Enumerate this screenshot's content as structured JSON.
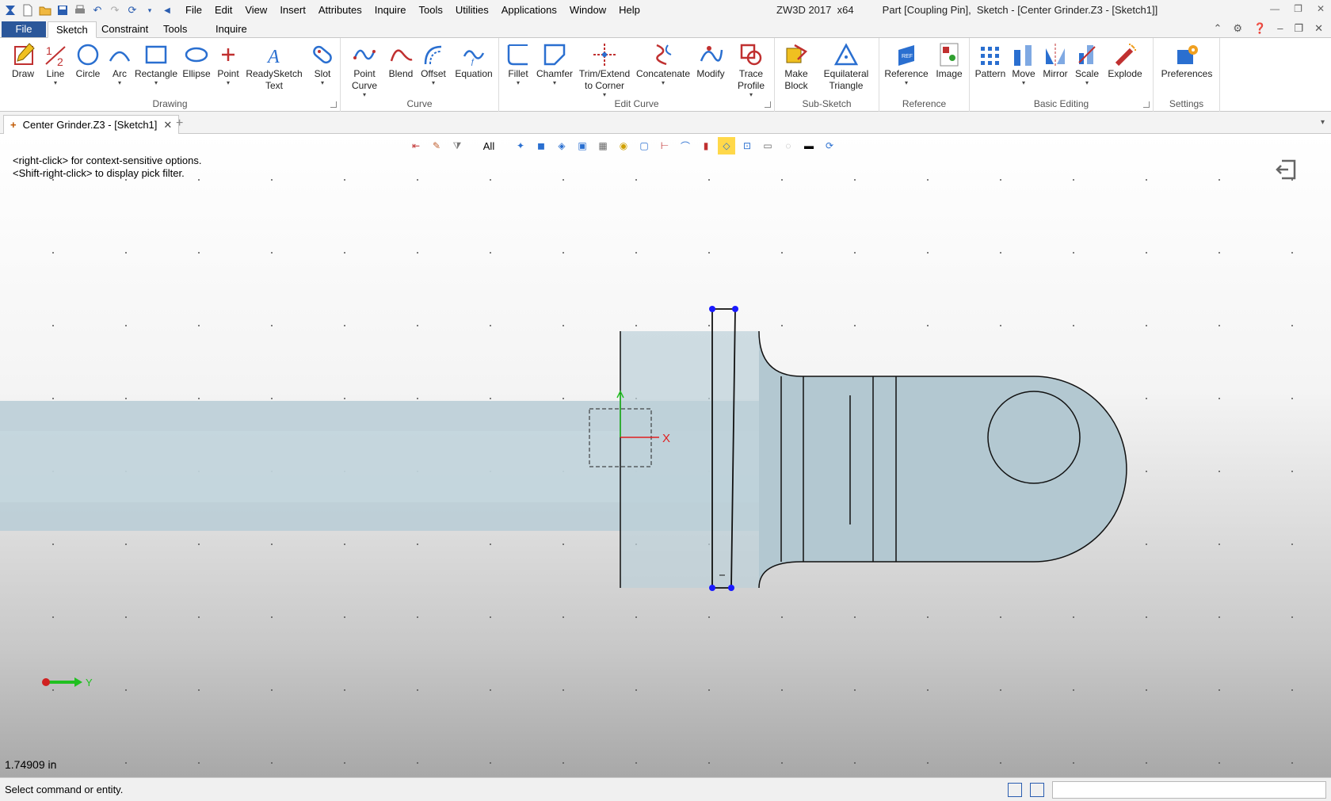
{
  "app": {
    "title": "ZW3D 2017  x64",
    "document_title": "Part [Coupling Pin],  Sketch - [Center Grinder.Z3 - [Sketch1]]"
  },
  "menu": [
    "File",
    "Edit",
    "View",
    "Insert",
    "Attributes",
    "Inquire",
    "Tools",
    "Utilities",
    "Applications",
    "Window",
    "Help"
  ],
  "ribbon_tabs": {
    "file": "File",
    "tabs": [
      "Sketch",
      "Constraint",
      "Tools",
      "Inquire"
    ],
    "active": "Sketch"
  },
  "ribbon": {
    "drawing": {
      "label": "Drawing",
      "buttons": [
        "Draw",
        "Line",
        "Circle",
        "Arc",
        "Rectangle",
        "Ellipse",
        "Point",
        "ReadySketch Text",
        "Slot"
      ]
    },
    "curve": {
      "label": "Curve",
      "buttons": [
        "Point Curve",
        "Blend",
        "Offset",
        "Equation"
      ]
    },
    "edit_curve": {
      "label": "Edit Curve",
      "buttons": [
        "Fillet",
        "Chamfer",
        "Trim/Extend to Corner",
        "Concatenate",
        "Modify",
        "Trace Profile"
      ]
    },
    "sub_sketch": {
      "label": "Sub-Sketch",
      "buttons": [
        "Make Block",
        "Equilateral Triangle"
      ]
    },
    "reference": {
      "label": "Reference",
      "buttons": [
        "Reference",
        "Image"
      ]
    },
    "basic_editing": {
      "label": "Basic Editing",
      "buttons": [
        "Pattern",
        "Move",
        "Mirror",
        "Scale",
        "Explode"
      ]
    },
    "settings": {
      "label": "Settings",
      "buttons": [
        "Preferences"
      ]
    }
  },
  "doc_tab": {
    "label": "Center Grinder.Z3 - [Sketch1]"
  },
  "viewport": {
    "filter": "All",
    "hint_line1": "<right-click> for context-sensitive options.",
    "hint_line2": "<Shift-right-click> to display pick filter.",
    "axis_x": "X",
    "axis_y": "Y",
    "measure": "1.74909 in"
  },
  "status": {
    "text": "Select command or entity."
  },
  "colors": {
    "accent": "#2b579a",
    "sketch_vertex": "#1a1aff",
    "part_fill": "#b9cdd6"
  }
}
